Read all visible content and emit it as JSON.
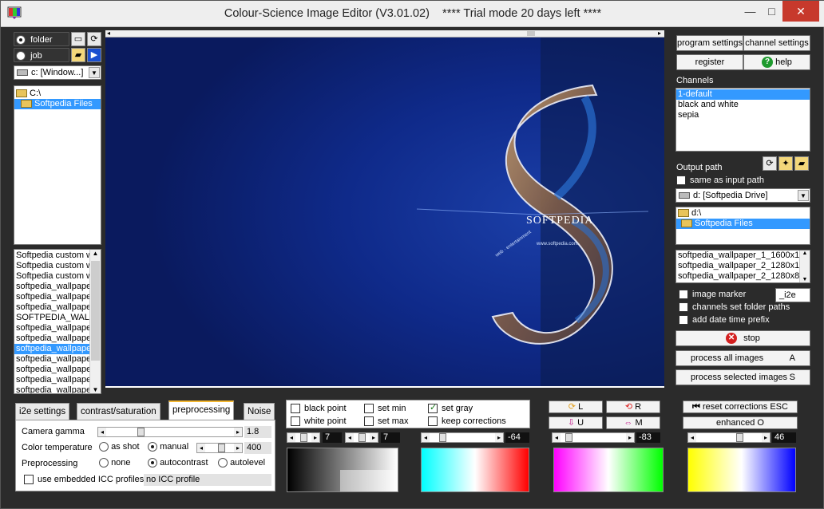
{
  "window": {
    "title": "Colour-Science Image Editor (V3.01.02)    **** Trial mode 20 days left ****",
    "minimize": "—",
    "maximize": "□",
    "close": "✕"
  },
  "left": {
    "folder_label": "folder",
    "job_label": "job",
    "drive": "c: [Window...]",
    "folders": [
      "C:\\",
      "Softpedia Files"
    ],
    "files": [
      "Softpedia custom w",
      "Softpedia custom w",
      "Softpedia custom w",
      "softpedia_wallpape",
      "softpedia_wallpape",
      "softpedia_wallpape",
      "SOFTPEDIA_WAL",
      "softpedia_wallpape",
      "softpedia_wallpape",
      "softpedia_wallpape",
      "softpedia_wallpape",
      "softpedia_wallpape",
      "softpedia_wallpape",
      "softpedia_wallpape"
    ],
    "selected_file_index": 9
  },
  "preview": {
    "brand": "SOFTPEDIA",
    "url": "www.softpedia.com",
    "ribbon": "web · entertainment"
  },
  "right": {
    "program_settings": "program settings",
    "channel_settings": "channel settings",
    "register": "register",
    "help": "help",
    "channels_label": "Channels",
    "channels": [
      "1-default",
      "black and white",
      "sepia"
    ],
    "output_path_label": "Output path",
    "same_as_input": "same as input path",
    "drive": "d: [Softpedia Drive]",
    "folders": [
      "d:\\",
      "Softpedia Files"
    ],
    "files": [
      "softpedia_wallpaper_1_1600x1",
      "softpedia_wallpaper_2_1280x1",
      "softpedia_wallpaper_2_1280x8"
    ],
    "image_marker": "image marker",
    "image_marker_value": "_i2e",
    "channels_set_folder": "channels set folder paths",
    "add_date_prefix": "add date time prefix",
    "stop": "stop",
    "process_all": "process all images",
    "process_all_key": "A",
    "process_selected": "process selected images",
    "process_selected_key": "S"
  },
  "tabs": {
    "items": [
      "i2e settings",
      "contrast/saturation",
      "preprocessing",
      "Noise"
    ],
    "active_index": 2
  },
  "preprocessing": {
    "camera_gamma_label": "Camera gamma",
    "camera_gamma_value": "1.8",
    "color_temp_label": "Color temperature",
    "as_shot": "as shot",
    "manual": "manual",
    "color_temp_value": "400",
    "preprocessing_label": "Preprocessing",
    "none": "none",
    "autocontrast": "autocontrast",
    "autolevel": "autolevel",
    "use_icc": "use embedded ICC profiles",
    "icc_value": "no ICC profile"
  },
  "points": {
    "black_point": "black point",
    "white_point": "white point",
    "set_min": "set min",
    "set_max": "set max",
    "set_gray": "set gray",
    "keep_corrections": "keep corrections",
    "bp_value": "7",
    "wp_value": "7",
    "gray_value": "-64"
  },
  "color": {
    "L": "L",
    "R": "R",
    "U": "U",
    "M": "M",
    "value": "-83"
  },
  "corrections": {
    "reset": "reset corrections ESC",
    "enhanced": "enhanced  O",
    "value": "46"
  },
  "colors": {
    "window_bg": "#2b2b2b",
    "panel": "#f0f0f0",
    "selection": "#3399ff",
    "close_red": "#c7392c"
  }
}
